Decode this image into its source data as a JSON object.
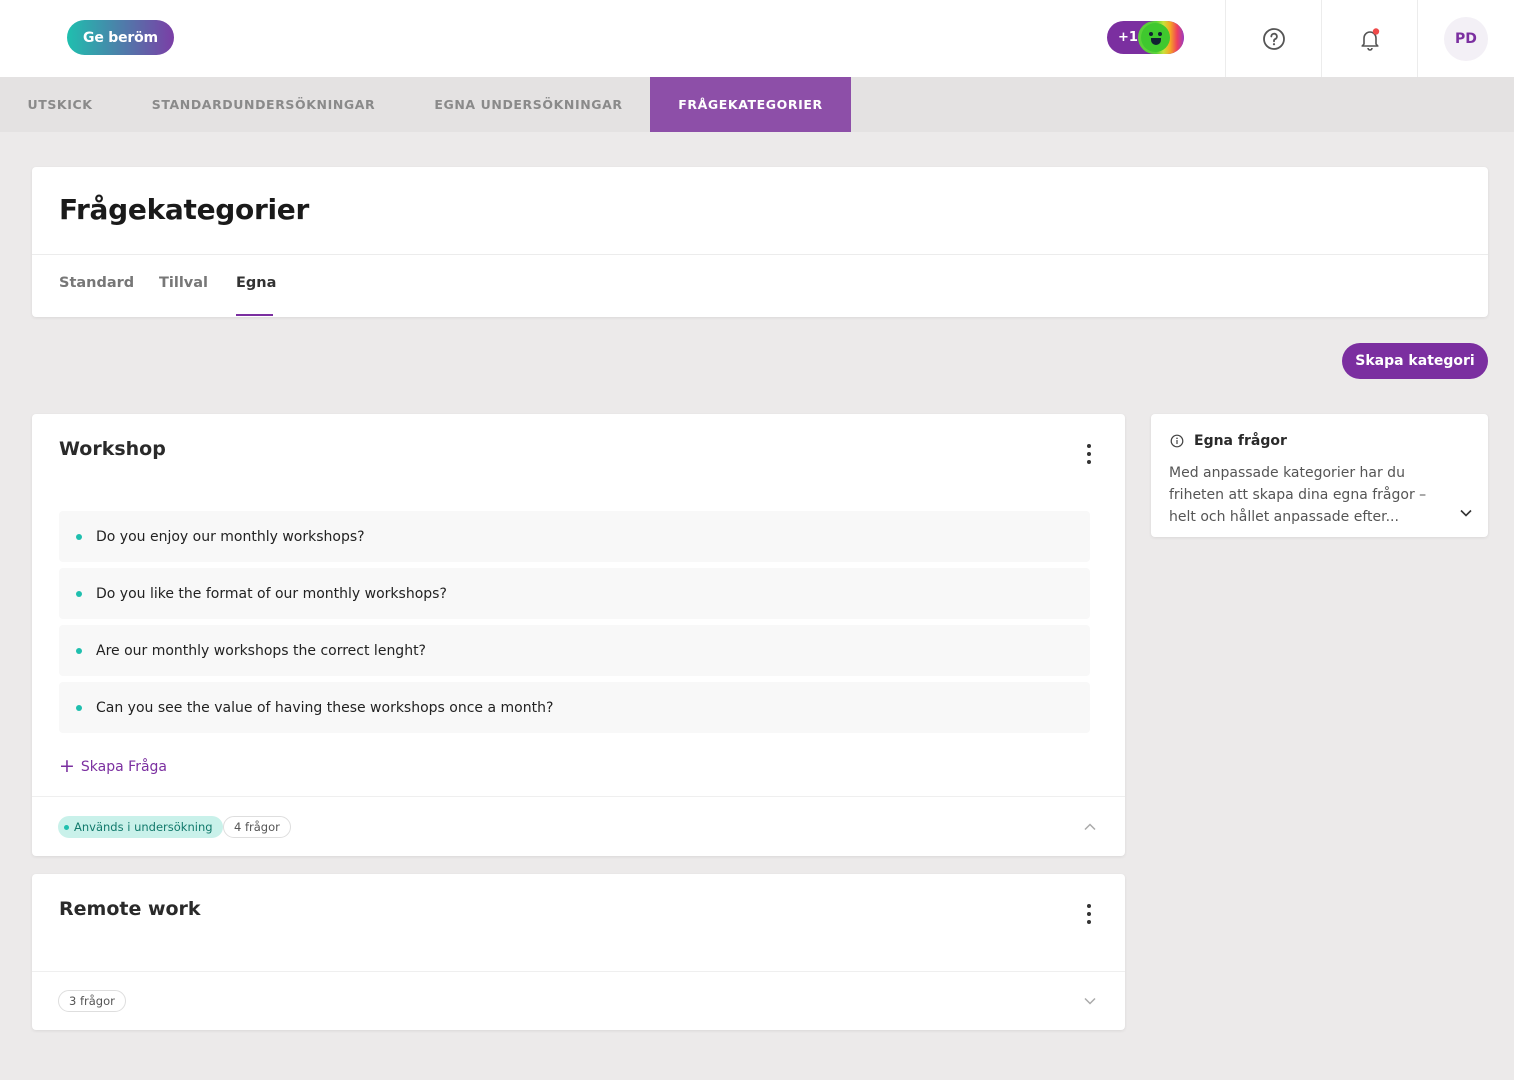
{
  "topbar": {
    "praise_button": "Ge beröm",
    "kudos_count": "+1",
    "avatar_initials": "PD"
  },
  "main_nav": {
    "tabs": [
      {
        "label": "UTSKICK",
        "active": false
      },
      {
        "label": "STANDARDUNDERSÖKNINGAR",
        "active": false
      },
      {
        "label": "EGNA UNDERSÖKNINGAR",
        "active": false
      },
      {
        "label": "FRÅGEKATEGORIER",
        "active": true
      }
    ]
  },
  "page": {
    "title": "Frågekategorier",
    "subtabs": [
      {
        "label": "Standard",
        "active": false
      },
      {
        "label": "Tillval",
        "active": false
      },
      {
        "label": "Egna",
        "active": true
      }
    ],
    "create_category_button": "Skapa kategori"
  },
  "categories": [
    {
      "title": "Workshop",
      "expanded": true,
      "questions": [
        "Do you enjoy our monthly workshops?",
        "Do you like the format of our monthly workshops?",
        "Are our monthly workshops the correct lenght?",
        "Can you see the value of having these workshops once a month?"
      ],
      "add_question_label": "Skapa Fråga",
      "used_badge": "Används i undersökning",
      "count_badge": "4 frågor"
    },
    {
      "title": "Remote work",
      "expanded": false,
      "count_badge": "3 frågor"
    }
  ],
  "info_panel": {
    "title": "Egna frågor",
    "text": "Med anpassade kategorier har du friheten att skapa dina egna frågor – helt och hållet anpassade efter..."
  },
  "colors": {
    "accent": "#7b2fa0",
    "active_tab_bg": "#8d4fa8",
    "teal": "#1fbfae"
  }
}
